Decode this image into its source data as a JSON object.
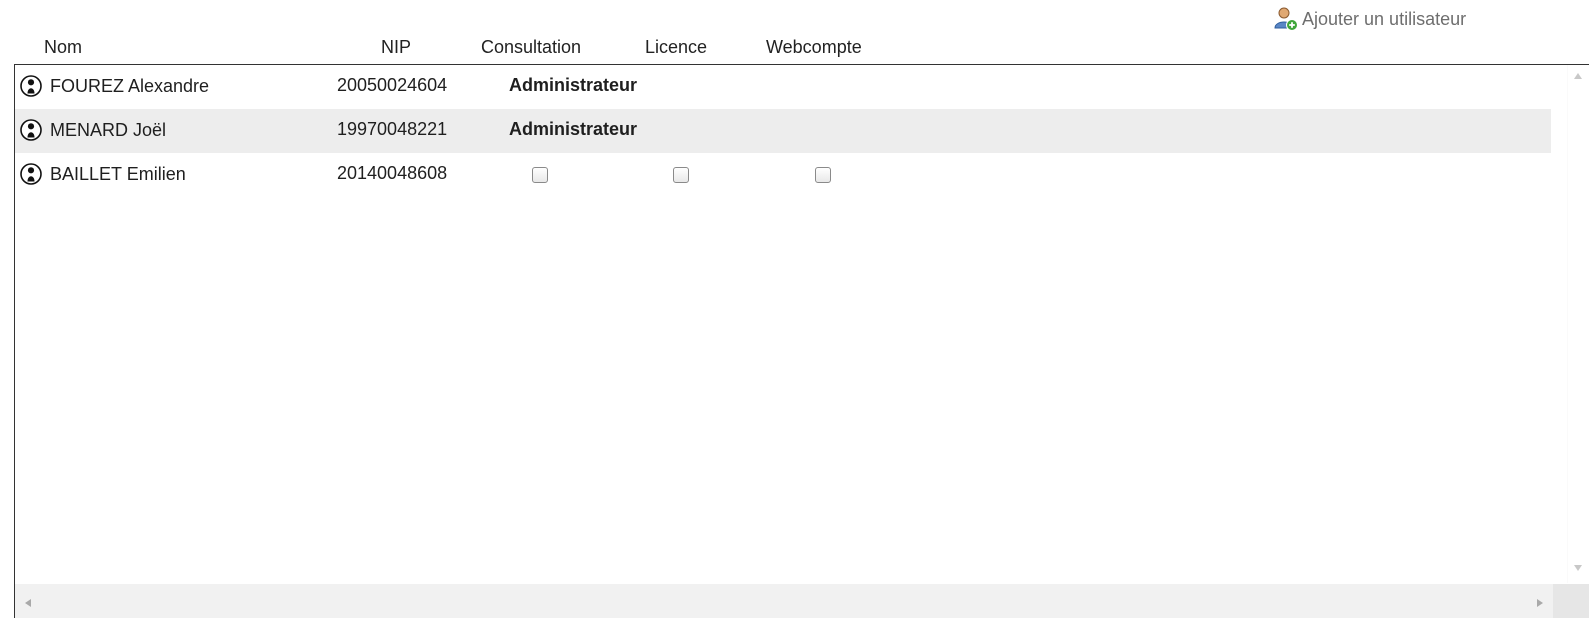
{
  "actions": {
    "add_user_label": "Ajouter un utilisateur"
  },
  "columns": {
    "name": "Nom",
    "nip": "NIP",
    "consultation": "Consultation",
    "licence": "Licence",
    "webcompte": "Webcompte"
  },
  "rows": [
    {
      "name": "FOUREZ Alexandre",
      "nip": "20050024604",
      "role": "Administrateur"
    },
    {
      "name": "MENARD Joël",
      "nip": "19970048221",
      "role": "Administrateur"
    },
    {
      "name": "BAILLET Emilien",
      "nip": "20140048608",
      "consultation": false,
      "licence": false,
      "webcompte": false
    }
  ],
  "icons": {
    "add_user": "add-user-icon",
    "row_user": "user-info-icon"
  },
  "colors": {
    "alt_row": "#ededed",
    "border": "#333333",
    "link_text": "#6e6e6e"
  }
}
